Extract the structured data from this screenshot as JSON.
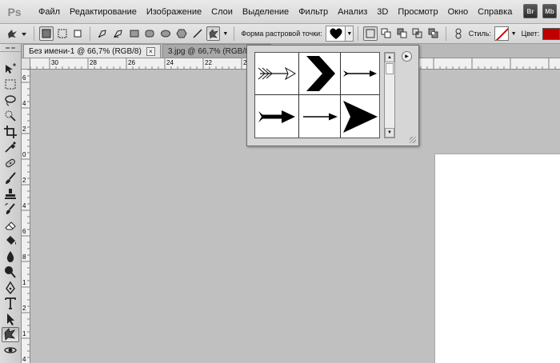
{
  "app": {
    "logo_text": "Ps"
  },
  "menu": {
    "items": [
      {
        "label": "Файл"
      },
      {
        "label": "Редактирование"
      },
      {
        "label": "Изображение"
      },
      {
        "label": "Слои"
      },
      {
        "label": "Выделение"
      },
      {
        "label": "Фильтр"
      },
      {
        "label": "Анализ"
      },
      {
        "label": "3D"
      },
      {
        "label": "Просмотр"
      },
      {
        "label": "Окно"
      },
      {
        "label": "Справка"
      }
    ],
    "bridge_label": "Br",
    "minibridge_label": "Mb"
  },
  "options_bar": {
    "shape_label": "Форма растровой точки:",
    "style_label": "Стиль:",
    "color_label": "Цвет:",
    "color_value": "#c00000",
    "current_shape_icon": "heart-icon"
  },
  "tabs": [
    {
      "label": "Без имени-1 @ 66,7% (RGB/8)",
      "active": true,
      "close": "×"
    },
    {
      "label": "3.jpg @ 66,7% (RGB/8)",
      "active": false,
      "close": "×"
    }
  ],
  "ruler_h": {
    "labels": [
      "30",
      "28",
      "26",
      "24",
      "22",
      "20",
      "18",
      "16"
    ]
  },
  "ruler_v": {
    "labels": [
      "6",
      "4",
      "2",
      "0",
      "2",
      "4",
      "6",
      "8",
      "1",
      "2",
      "1",
      "4"
    ]
  },
  "shape_picker": {
    "shapes": [
      {
        "name": "feathered-arrow-shape"
      },
      {
        "name": "chevron-shape"
      },
      {
        "name": "thin-arrow-shape"
      },
      {
        "name": "bold-arrow-shape"
      },
      {
        "name": "line-arrow-shape"
      },
      {
        "name": "triangle-arrow-shape"
      }
    ]
  },
  "tools": [
    {
      "name": "move-tool-icon"
    },
    {
      "name": "marquee-tool-icon"
    },
    {
      "name": "lasso-tool-icon"
    },
    {
      "name": "quick-select-tool-icon"
    },
    {
      "name": "crop-tool-icon"
    },
    {
      "name": "eyedropper-tool-icon"
    },
    {
      "name": "healing-brush-tool-icon"
    },
    {
      "name": "brush-tool-icon"
    },
    {
      "name": "clone-stamp-tool-icon"
    },
    {
      "name": "history-brush-tool-icon"
    },
    {
      "name": "eraser-tool-icon"
    },
    {
      "name": "paint-bucket-tool-icon"
    },
    {
      "name": "blur-tool-icon"
    },
    {
      "name": "dodge-tool-icon"
    },
    {
      "name": "pen-tool-icon"
    },
    {
      "name": "type-tool-icon"
    },
    {
      "name": "path-select-tool-icon"
    },
    {
      "name": "custom-shape-tool-icon"
    },
    {
      "name": "3d-rotate-tool-icon"
    }
  ]
}
